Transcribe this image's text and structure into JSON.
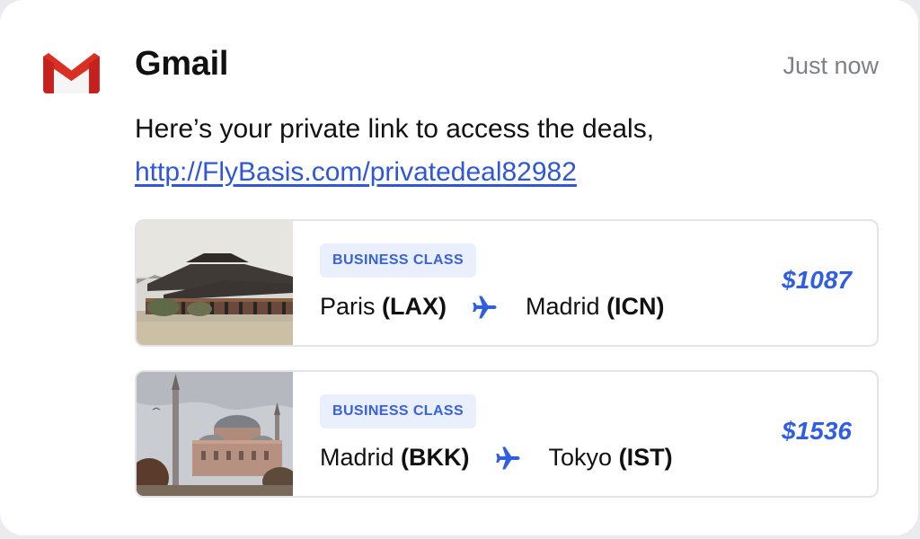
{
  "notification": {
    "app_name": "Gmail",
    "time": "Just now",
    "message_text": "Here’s your private link to access the deals,",
    "link": "http://FlyBasis.com/privatedeal82982"
  },
  "deals": [
    {
      "class": "BUSINESS CLASS",
      "from_city": "Paris",
      "from_code": "(LAX)",
      "to_city": "Madrid",
      "to_code": "(ICN)",
      "price": "$1087"
    },
    {
      "class": "BUSINESS CLASS",
      "from_city": "Madrid",
      "from_code": "(BKK)",
      "to_city": "Tokyo",
      "to_code": "(IST)",
      "price": "$1536"
    }
  ],
  "icons": {
    "logo": "gmail-logo-icon",
    "plane": "airplane-icon"
  },
  "colors": {
    "link": "#2f57d6",
    "price": "#2f5fe0",
    "badge_bg": "#e9effd",
    "badge_text": "#3a62d8",
    "gmail_red": "#d93025"
  }
}
